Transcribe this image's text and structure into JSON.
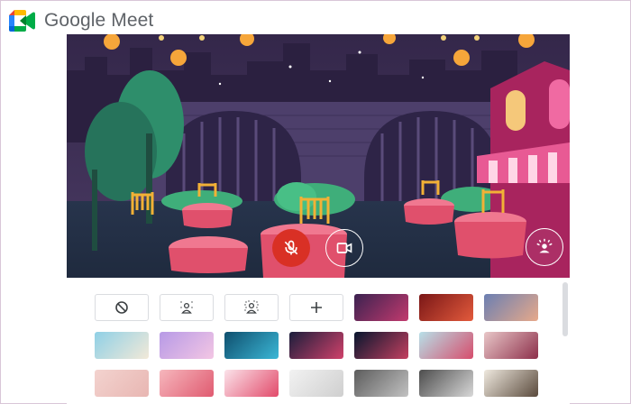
{
  "app": {
    "title": "Google Meet",
    "brand_colors": [
      "#00832d",
      "#0066da",
      "#e94235",
      "#2684fc",
      "#00ac47",
      "#ffba00"
    ]
  },
  "preview": {
    "scene": "restaurant-night-background",
    "controls": [
      {
        "name": "microphone-off-button",
        "icon": "mic-off-icon",
        "state": "muted",
        "color": "#d93025"
      },
      {
        "name": "camera-button",
        "icon": "video-camera-icon",
        "state": "on"
      },
      {
        "name": "visual-effects-button",
        "icon": "visual-effects-icon"
      }
    ]
  },
  "effects": {
    "options": [
      {
        "icon": "no-effect-icon",
        "glyph": "⃠",
        "text": ""
      },
      {
        "icon": "slight-blur-icon",
        "text": ""
      },
      {
        "icon": "blur-icon",
        "text": ""
      },
      {
        "icon": "add-icon",
        "glyph": "+",
        "text": ""
      }
    ],
    "backgrounds": [
      {
        "name": "bg-restaurant",
        "colors": [
          "#3b2250",
          "#c23a6e"
        ]
      },
      {
        "name": "bg-lanterns",
        "colors": [
          "#7a1717",
          "#e35a3c"
        ]
      },
      {
        "name": "bg-sunset",
        "colors": [
          "#6b7fb2",
          "#e7a98a"
        ]
      },
      {
        "name": "bg-beach",
        "colors": [
          "#8fd0e6",
          "#f2e9d8"
        ]
      },
      {
        "name": "bg-clouds",
        "colors": [
          "#b79ae6",
          "#f3c6e4"
        ]
      },
      {
        "name": "bg-underwater",
        "colors": [
          "#0f4f6e",
          "#3bb7d6"
        ]
      },
      {
        "name": "bg-galaxy",
        "colors": [
          "#1b1e3c",
          "#d0416a"
        ]
      },
      {
        "name": "bg-fireworks",
        "colors": [
          "#07162e",
          "#c44060"
        ]
      },
      {
        "name": "bg-cherry-blossom",
        "colors": [
          "#b7e0e8",
          "#d64d6c"
        ]
      },
      {
        "name": "bg-flowers",
        "colors": [
          "#e8c7c8",
          "#8d2f4a"
        ]
      },
      {
        "name": "bg-pink-wall",
        "colors": [
          "#f3d3cf",
          "#e8b6b2"
        ]
      },
      {
        "name": "bg-pink-pattern",
        "colors": [
          "#f6b7bd",
          "#e05a70"
        ]
      },
      {
        "name": "bg-confetti",
        "colors": [
          "#fbe3ea",
          "#e24a6a"
        ]
      },
      {
        "name": "bg-white-room",
        "colors": [
          "#f2f2f2",
          "#cfcfcf"
        ]
      },
      {
        "name": "bg-grey-interior",
        "colors": [
          "#5c5c5c",
          "#c2c2c2"
        ]
      },
      {
        "name": "bg-office",
        "colors": [
          "#4d4d4d",
          "#d8d8d8"
        ]
      },
      {
        "name": "bg-bookshelf",
        "colors": [
          "#efe9df",
          "#5a4a3c"
        ]
      }
    ]
  }
}
